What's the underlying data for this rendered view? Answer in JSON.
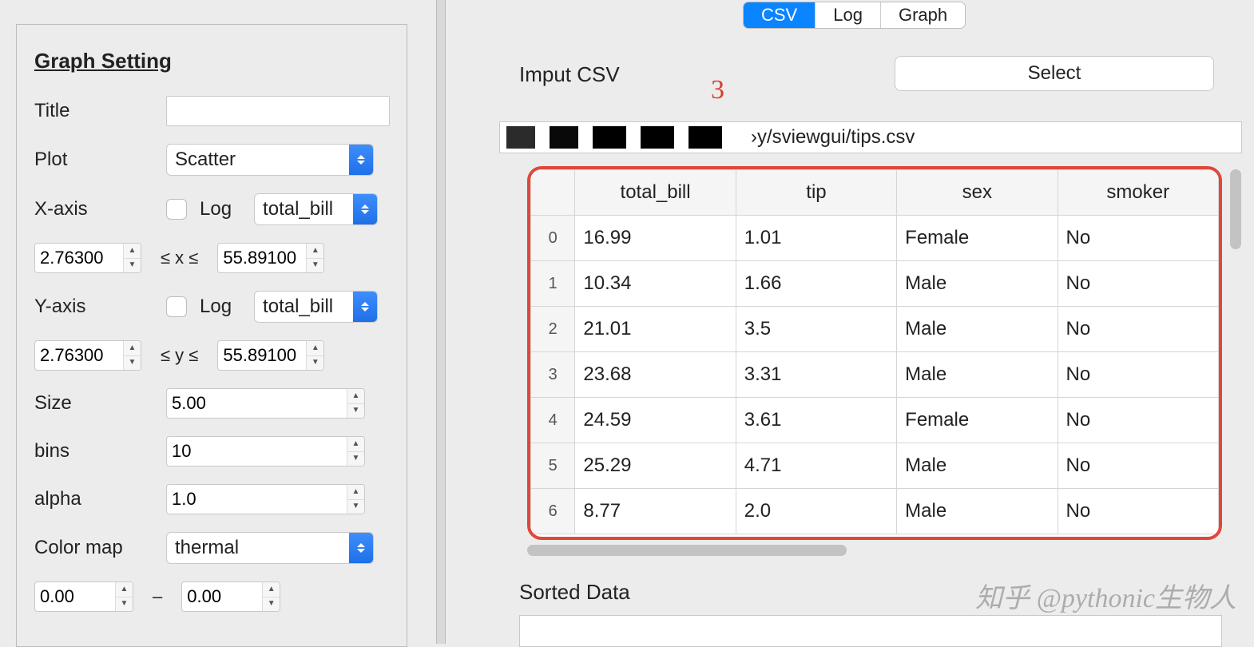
{
  "left": {
    "heading": "Graph Setting",
    "title_label": "Title",
    "title_value": "",
    "plot_label": "Plot",
    "plot_value": "Scatter",
    "xaxis_label": "X-axis",
    "yaxis_label": "Y-axis",
    "log_label": "Log",
    "x_select": "total_bill",
    "y_select": "total_bill",
    "x_min": "2.76300",
    "x_max": "55.89100",
    "x_range_text": "≤  x  ≤",
    "y_min": "2.76300",
    "y_max": "55.89100",
    "y_range_text": "≤  y  ≤",
    "size_label": "Size",
    "size_value": "5.00",
    "bins_label": "bins",
    "bins_value": "10",
    "alpha_label": "alpha",
    "alpha_value": "1.0",
    "cmap_label": "Color map",
    "cmap_value": "thermal",
    "cmap_min": "0.00",
    "cmap_dash": "–",
    "cmap_max": "0.00"
  },
  "tabs": {
    "csv": "CSV",
    "log": "Log",
    "graph": "Graph",
    "active": "csv"
  },
  "right": {
    "input_label": "Imput CSV",
    "annot": "3",
    "select_btn": "Select",
    "path_suffix": "›y/sviewgui/tips.csv",
    "sorted_label": "Sorted Data"
  },
  "table": {
    "headers": [
      "",
      "total_bill",
      "tip",
      "sex",
      "smoker"
    ],
    "rows": [
      {
        "idx": "0",
        "cells": [
          "16.99",
          "1.01",
          "Female",
          "No"
        ]
      },
      {
        "idx": "1",
        "cells": [
          "10.34",
          "1.66",
          "Male",
          "No"
        ]
      },
      {
        "idx": "2",
        "cells": [
          "21.01",
          "3.5",
          "Male",
          "No"
        ]
      },
      {
        "idx": "3",
        "cells": [
          "23.68",
          "3.31",
          "Male",
          "No"
        ]
      },
      {
        "idx": "4",
        "cells": [
          "24.59",
          "3.61",
          "Female",
          "No"
        ]
      },
      {
        "idx": "5",
        "cells": [
          "25.29",
          "4.71",
          "Male",
          "No"
        ]
      },
      {
        "idx": "6",
        "cells": [
          "8.77",
          "2.0",
          "Male",
          "No"
        ]
      }
    ]
  },
  "watermark": "知乎 @pythonic生物人"
}
